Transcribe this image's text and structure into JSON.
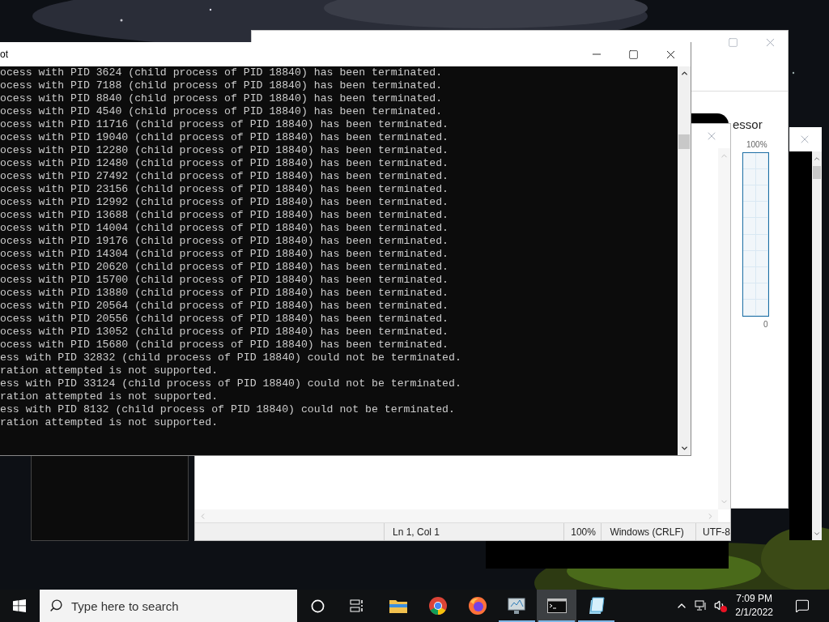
{
  "task_manager": {
    "heading": "essor",
    "graph_max": "100%",
    "graph_min": "0"
  },
  "console": {
    "title": "ot",
    "lines": [
      "ocess with PID 3624 (child process of PID 18840) has been terminated.",
      "ocess with PID 7188 (child process of PID 18840) has been terminated.",
      "ocess with PID 8840 (child process of PID 18840) has been terminated.",
      "ocess with PID 4540 (child process of PID 18840) has been terminated.",
      "ocess with PID 11716 (child process of PID 18840) has been terminated.",
      "ocess with PID 19040 (child process of PID 18840) has been terminated.",
      "ocess with PID 12280 (child process of PID 18840) has been terminated.",
      "ocess with PID 12480 (child process of PID 18840) has been terminated.",
      "ocess with PID 27492 (child process of PID 18840) has been terminated.",
      "ocess with PID 23156 (child process of PID 18840) has been terminated.",
      "ocess with PID 12992 (child process of PID 18840) has been terminated.",
      "ocess with PID 13688 (child process of PID 18840) has been terminated.",
      "ocess with PID 14004 (child process of PID 18840) has been terminated.",
      "ocess with PID 19176 (child process of PID 18840) has been terminated.",
      "ocess with PID 14304 (child process of PID 18840) has been terminated.",
      "ocess with PID 20620 (child process of PID 18840) has been terminated.",
      "ocess with PID 15700 (child process of PID 18840) has been terminated.",
      "ocess with PID 13880 (child process of PID 18840) has been terminated.",
      "ocess with PID 20564 (child process of PID 18840) has been terminated.",
      "ocess with PID 20556 (child process of PID 18840) has been terminated.",
      "ocess with PID 13052 (child process of PID 18840) has been terminated.",
      "ocess with PID 15680 (child process of PID 18840) has been terminated.",
      "ess with PID 32832 (child process of PID 18840) could not be terminated.",
      "ration attempted is not supported.",
      "ess with PID 33124 (child process of PID 18840) could not be terminated.",
      "ration attempted is not supported.",
      "ess with PID 8132 (child process of PID 18840) could not be terminated.",
      "ration attempted is not supported."
    ]
  },
  "notepad": {
    "status_bar": [
      "Ln 1, Col 1",
      "100%",
      "Windows (CRLF)",
      "UTF-8"
    ]
  },
  "taskbar": {
    "search_placeholder": "Type here to search",
    "apps": [
      {
        "kind": "folder",
        "selected": false,
        "running": false
      },
      {
        "kind": "chrome",
        "selected": false,
        "running": false
      },
      {
        "kind": "firefox",
        "selected": false,
        "running": false
      },
      {
        "kind": "monitor",
        "selected": false,
        "running": true
      },
      {
        "kind": "terminal",
        "selected": true,
        "running": true
      },
      {
        "kind": "notepad",
        "selected": false,
        "running": true
      }
    ],
    "time": "7:09 PM",
    "date": "2/1/2022"
  }
}
